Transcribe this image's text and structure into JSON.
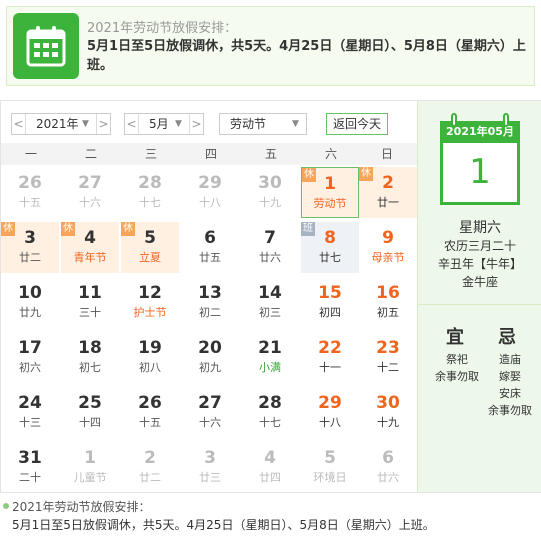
{
  "notice": {
    "title": "2021年劳动节放假安排：",
    "body": "5月1日至5日放假调休，共5天。4月25日（星期日）、5月8日（星期六）上班。"
  },
  "toolbar": {
    "prev_year": "<",
    "year": "2021年",
    "next_year": ">",
    "prev_month": "<",
    "month": "5月",
    "next_month": ">",
    "holiday": "劳动节",
    "today_button": "返回今天"
  },
  "weekdays": [
    "一",
    "二",
    "三",
    "四",
    "五",
    "六",
    "日"
  ],
  "days": [
    {
      "d": "26",
      "l": "十五",
      "t": "gray"
    },
    {
      "d": "27",
      "l": "十六",
      "t": "gray"
    },
    {
      "d": "28",
      "l": "十七",
      "t": "gray"
    },
    {
      "d": "29",
      "l": "十八",
      "t": "gray"
    },
    {
      "d": "30",
      "l": "十九",
      "t": "gray"
    },
    {
      "d": "1",
      "l": "劳动节",
      "t": "weekend fest selected",
      "tag": "休"
    },
    {
      "d": "2",
      "l": "廿一",
      "t": "weekend holiday",
      "tag": "休"
    },
    {
      "d": "3",
      "l": "廿二",
      "t": "normal holiday",
      "tag": "休"
    },
    {
      "d": "4",
      "l": "青年节",
      "t": "normal fest holiday",
      "tag": "休"
    },
    {
      "d": "5",
      "l": "立夏",
      "t": "normal fest holiday",
      "tag": "休"
    },
    {
      "d": "6",
      "l": "廿五",
      "t": "normal"
    },
    {
      "d": "7",
      "l": "廿六",
      "t": "normal"
    },
    {
      "d": "8",
      "l": "廿七",
      "t": "weekend work",
      "tag": "班"
    },
    {
      "d": "9",
      "l": "母亲节",
      "t": "weekend fest"
    },
    {
      "d": "10",
      "l": "廿九",
      "t": "normal"
    },
    {
      "d": "11",
      "l": "三十",
      "t": "normal"
    },
    {
      "d": "12",
      "l": "护士节",
      "t": "normal fest"
    },
    {
      "d": "13",
      "l": "初二",
      "t": "normal"
    },
    {
      "d": "14",
      "l": "初三",
      "t": "normal"
    },
    {
      "d": "15",
      "l": "初四",
      "t": "weekend"
    },
    {
      "d": "16",
      "l": "初五",
      "t": "weekend"
    },
    {
      "d": "17",
      "l": "初六",
      "t": "normal"
    },
    {
      "d": "18",
      "l": "初七",
      "t": "normal"
    },
    {
      "d": "19",
      "l": "初八",
      "t": "normal"
    },
    {
      "d": "20",
      "l": "初九",
      "t": "normal"
    },
    {
      "d": "21",
      "l": "小满",
      "t": "normal fest-green"
    },
    {
      "d": "22",
      "l": "十一",
      "t": "weekend"
    },
    {
      "d": "23",
      "l": "十二",
      "t": "weekend"
    },
    {
      "d": "24",
      "l": "十三",
      "t": "normal"
    },
    {
      "d": "25",
      "l": "十四",
      "t": "normal"
    },
    {
      "d": "26",
      "l": "十五",
      "t": "normal"
    },
    {
      "d": "27",
      "l": "十六",
      "t": "normal"
    },
    {
      "d": "28",
      "l": "十七",
      "t": "normal"
    },
    {
      "d": "29",
      "l": "十八",
      "t": "weekend"
    },
    {
      "d": "30",
      "l": "十九",
      "t": "weekend"
    },
    {
      "d": "31",
      "l": "二十",
      "t": "normal"
    },
    {
      "d": "1",
      "l": "儿童节",
      "t": "gray"
    },
    {
      "d": "2",
      "l": "廿二",
      "t": "gray"
    },
    {
      "d": "3",
      "l": "廿三",
      "t": "gray"
    },
    {
      "d": "4",
      "l": "廿四",
      "t": "gray"
    },
    {
      "d": "5",
      "l": "环境日",
      "t": "gray"
    },
    {
      "d": "6",
      "l": "廿六",
      "t": "gray"
    }
  ],
  "side": {
    "header": "2021年05月",
    "day": "1",
    "weekday": "星期六",
    "lunar1": "农历三月二十",
    "lunar2": "辛丑年【牛年】",
    "lunar3": "金牛座",
    "yi_title": "宜",
    "ji_title": "忌",
    "yi": [
      "祭祀",
      "余事勿取"
    ],
    "ji": [
      "造庙",
      "嫁娶",
      "安床",
      "余事勿取"
    ]
  },
  "footer": {
    "title": "2021年劳动节放假安排：",
    "body": "5月1日至5日放假调休，共5天。4月25日（星期日）、5月8日（星期六）上班。"
  },
  "colors": {
    "accent": "#3cb43c",
    "weekend": "#f0641e",
    "holiday_bg": "#fff0e2"
  }
}
